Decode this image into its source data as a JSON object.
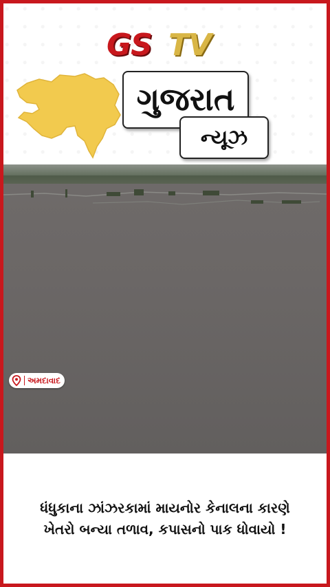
{
  "brand": {
    "logo_gs": "GS",
    "logo_tv": "TV",
    "colors": {
      "red": "#c8181d",
      "gold": "#d9b646",
      "map_yellow": "#f2ca4e"
    }
  },
  "header": {
    "title": "ગુજરાત",
    "subtitle": "ન્યૂઝ",
    "map_icon": "gujarat-map-icon"
  },
  "media": {
    "location_icon": "location-pin-icon",
    "location": "અમદાવાદ"
  },
  "caption": {
    "text": "ધંધુકાના ઝાંઝરકામાં માયનોર કેનાલના કારણે ખેતરો બન્યા તળાવ, કપાસનો પાક ધોવાયો !"
  }
}
